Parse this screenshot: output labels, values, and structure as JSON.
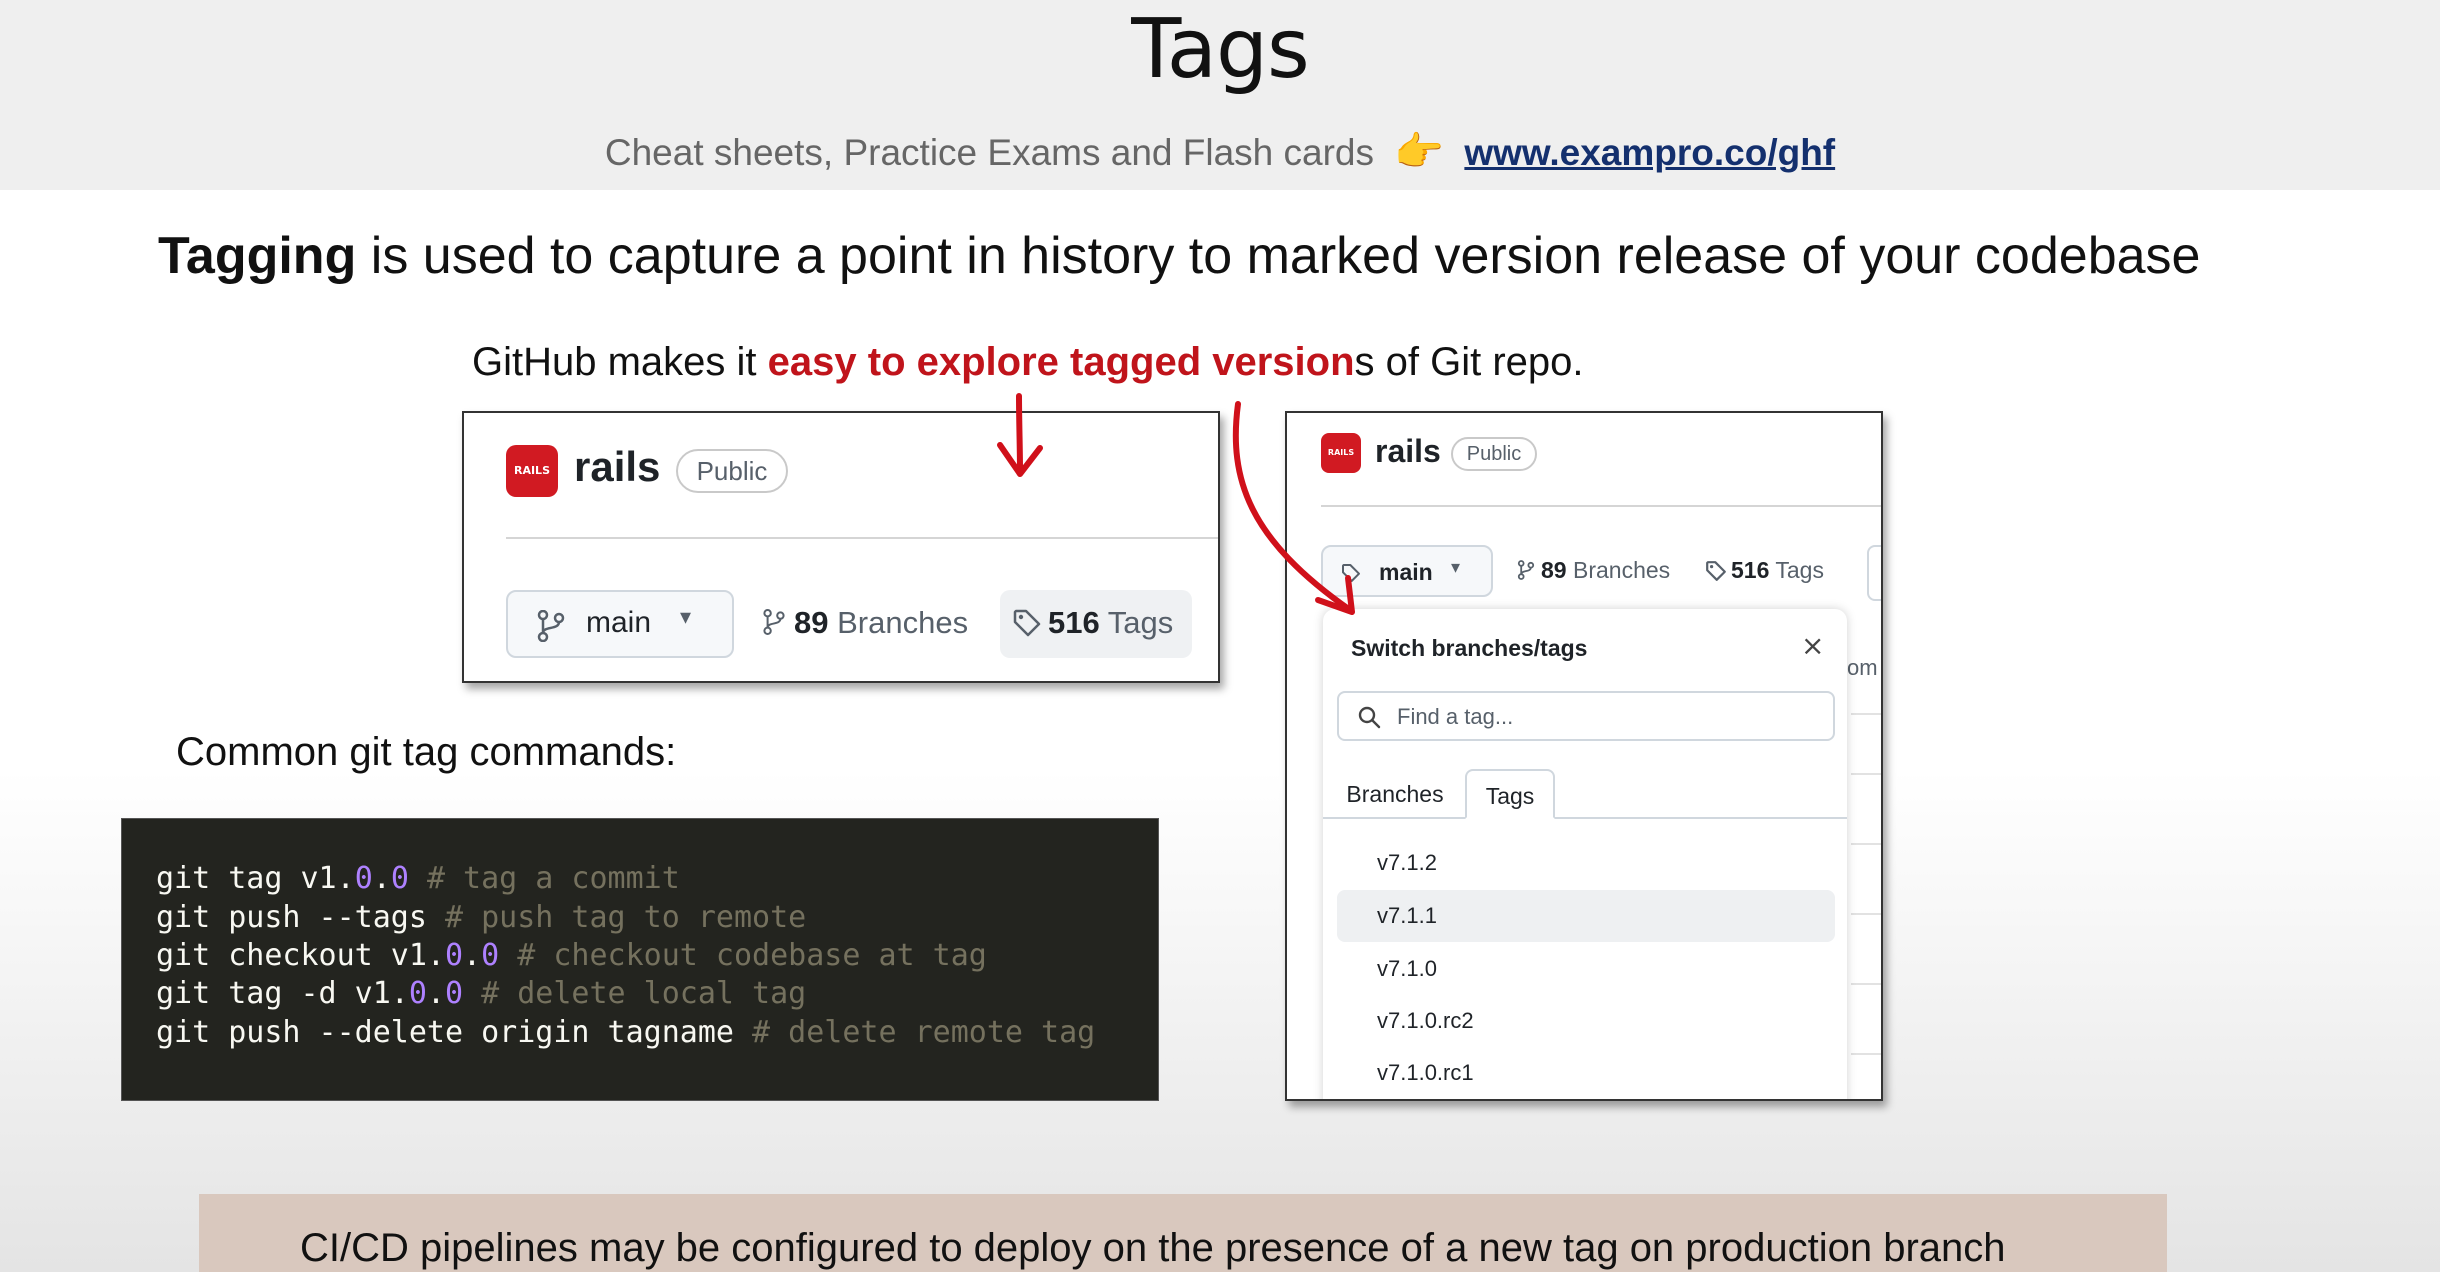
{
  "slide": {
    "title": "Tags",
    "subtitle_text": "Cheat sheets, Practice Exams and Flash cards",
    "subtitle_link": "www.exampro.co/ghf",
    "headline_bold": "Tagging",
    "headline_rest": " is used to capture a point in history to marked version release of your codebase",
    "explore_pre": "GitHub makes it ",
    "explore_red": "easy to explore tagged version",
    "explore_post": "s of Git repo.",
    "commands_heading": "Common git tag commands:",
    "footer": "CI/CD pipelines may be configured to deploy on the presence of a new tag on production branch"
  },
  "repo_card": {
    "logo_text": "RAILS",
    "name": "rails",
    "visibility": "Public",
    "branch": "main",
    "branches_count": "89",
    "branches_label": "Branches",
    "tags_count": "516",
    "tags_label": "Tags"
  },
  "switcher": {
    "logo_text": "RAILS",
    "name": "rails",
    "visibility": "Public",
    "branch": "main",
    "branches_count": "89",
    "branches_label": "Branches",
    "tags_count": "516",
    "tags_label": "Tags",
    "title": "Switch branches/tags",
    "close": "×",
    "search_placeholder": "Find a tag...",
    "tab_branches": "Branches",
    "tab_tags": "Tags",
    "partial_text": "om",
    "tags": [
      "v7.1.2",
      "v7.1.1",
      "v7.1.0",
      "v7.1.0.rc2",
      "v7.1.0.rc1"
    ]
  },
  "code": {
    "lines": [
      {
        "pre": "git tag v1.",
        "n1": "0",
        "mid": ".",
        "n2": "0",
        "post": " ",
        "comment": "# tag a commit"
      },
      {
        "pre": "git push --tags ",
        "n1": "",
        "mid": "",
        "n2": "",
        "post": "",
        "comment": "# push tag to remote"
      },
      {
        "pre": "git checkout v1.",
        "n1": "0",
        "mid": ".",
        "n2": "0",
        "post": " ",
        "comment": "# checkout codebase at tag"
      },
      {
        "pre": "git tag -d v1.",
        "n1": "0",
        "mid": ".",
        "n2": "0",
        "post": " ",
        "comment": "# delete local tag"
      },
      {
        "pre": "git push --delete origin tagname ",
        "n1": "",
        "mid": "",
        "n2": "",
        "post": "",
        "comment": "# delete remote tag"
      }
    ]
  },
  "colors": {
    "accent_red": "#c0141b",
    "rails_red": "#d11a22",
    "link_blue": "#14306e"
  }
}
